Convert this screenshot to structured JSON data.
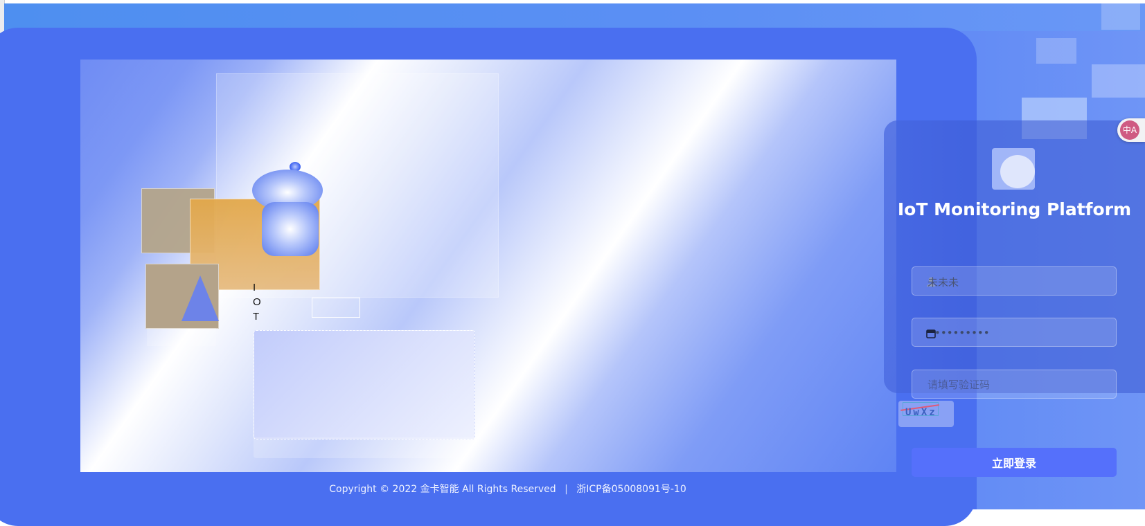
{
  "hero": {
    "iot_letters": [
      "I",
      "O",
      "T"
    ]
  },
  "login": {
    "title": "IoT Monitoring Platform",
    "username": {
      "value": "未未未",
      "icon": "user-icon"
    },
    "password": {
      "value": "●●●●●●●●●",
      "icon": "lock-icon"
    },
    "captcha": {
      "placeholder": "请填写验证码",
      "image_text": "UwXz"
    },
    "submit_label": "立即登录"
  },
  "translate_button": {
    "label": "中A",
    "icon": "translate-icon"
  },
  "footer": {
    "copyright": "Copyright © 2022 金卡智能 All Rights Reserved",
    "separator": "|",
    "icp": "浙ICP备05008091号-10"
  },
  "colors": {
    "background": "#4f7bf3",
    "accent_button": "#5570fb",
    "panel": "#3c5ad2",
    "card_orange": "#e3a84a"
  }
}
